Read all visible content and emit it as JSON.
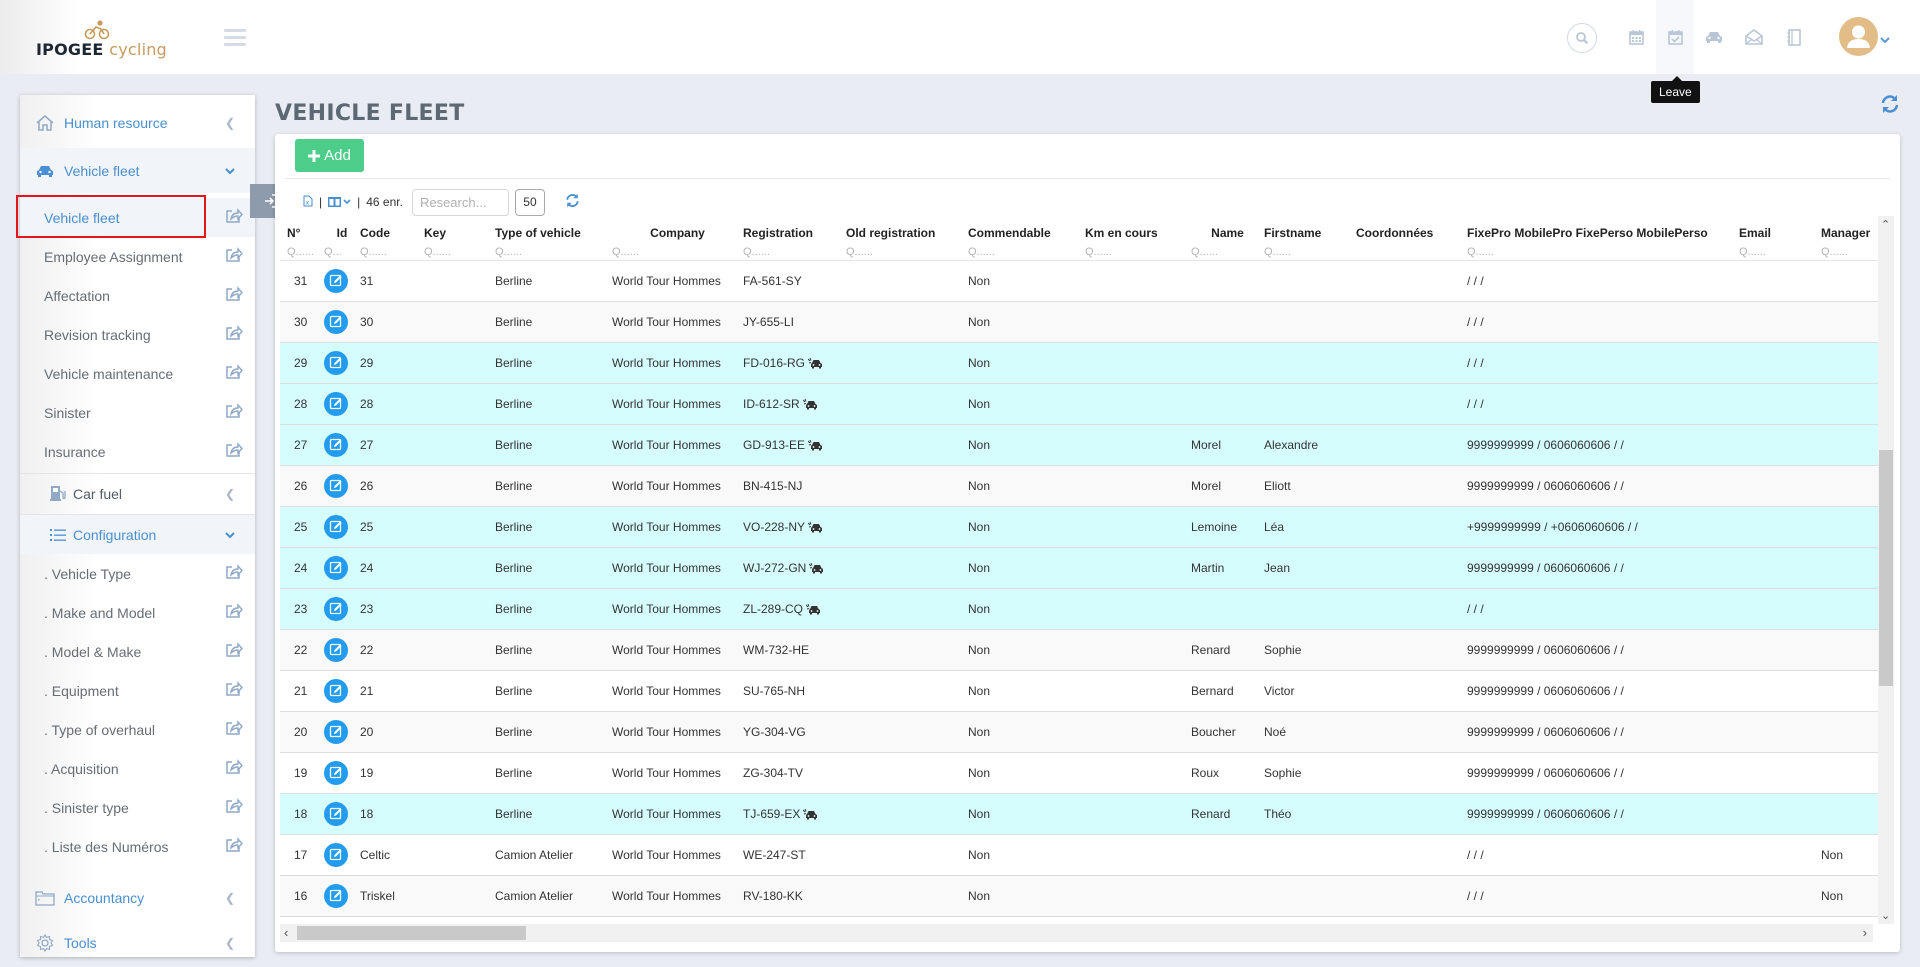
{
  "header": {
    "brand_main": "IPOGEE",
    "brand_sub": "cycling",
    "tooltip": "Leave",
    "icons": [
      "search-icon",
      "calendar-icon",
      "calendar-check-icon",
      "car-icon",
      "envelope-open-icon",
      "notebook-icon"
    ]
  },
  "sidebar": {
    "sections": [
      {
        "label": "Human resource",
        "icon": "home-icon",
        "state": "collapsed"
      },
      {
        "label": "Vehicle fleet",
        "icon": "car-icon",
        "state": "expanded"
      }
    ],
    "fleet_items": [
      {
        "label": "Vehicle fleet",
        "active": true
      },
      {
        "label": "Employee Assignment"
      },
      {
        "label": "Affectation"
      },
      {
        "label": "Revision tracking"
      },
      {
        "label": "Vehicle maintenance"
      },
      {
        "label": "Sinister"
      },
      {
        "label": "Insurance"
      }
    ],
    "car_fuel": {
      "label": "Car fuel",
      "icon": "fuel-pump-icon"
    },
    "configuration": {
      "label": "Configuration",
      "icon": "list-icon"
    },
    "config_items": [
      {
        "label": ". Vehicle Type"
      },
      {
        "label": ". Make and Model"
      },
      {
        "label": ". Model & Make"
      },
      {
        "label": ". Equipment"
      },
      {
        "label": ". Type of overhaul"
      },
      {
        "label": ". Acquisition"
      },
      {
        "label": ". Sinister type"
      },
      {
        "label": ". Liste des Numéros"
      }
    ],
    "accountancy": {
      "label": "Accountancy",
      "icon": "folder-icon"
    },
    "tools": {
      "label": "Tools",
      "icon": "gear-icon"
    }
  },
  "main": {
    "title": "VEHICLE FLEET",
    "add_label": "Add",
    "record_count": "46 enr.",
    "search_placeholder": "Research...",
    "page_size": "50",
    "filter_placeholder": "Q......",
    "filter_placeholder_short": "Q...",
    "columns": [
      "N°",
      "Id",
      "Code",
      "Key",
      "Type of vehicle",
      "Company",
      "Registration",
      "Old registration",
      "Commendable",
      "Km en cours",
      "Name",
      "Firstname",
      "Coordonnées",
      "FixePro MobilePro FixePerso MobilePerso",
      "Email",
      "Manager"
    ],
    "rows": [
      {
        "n": "31",
        "code": "31",
        "key": "",
        "type": "Berline",
        "company": "World Tour Hommes",
        "registration": "FA-561-SY",
        "car_flag": false,
        "old_reg": "",
        "commendable": "Non",
        "km": "",
        "name": "",
        "firstname": "",
        "coords": "",
        "phones": "/ / /",
        "email": "",
        "manager": "",
        "style": "odd"
      },
      {
        "n": "30",
        "code": "30",
        "key": "",
        "type": "Berline",
        "company": "World Tour Hommes",
        "registration": "JY-655-LI",
        "car_flag": false,
        "old_reg": "",
        "commendable": "Non",
        "km": "",
        "name": "",
        "firstname": "",
        "coords": "",
        "phones": "/ / /",
        "email": "",
        "manager": "",
        "style": "even"
      },
      {
        "n": "29",
        "code": "29",
        "key": "",
        "type": "Berline",
        "company": "World Tour Hommes",
        "registration": "FD-016-RG",
        "car_flag": true,
        "old_reg": "",
        "commendable": "Non",
        "km": "",
        "name": "",
        "firstname": "",
        "coords": "",
        "phones": "/ / /",
        "email": "",
        "manager": "",
        "style": "hl"
      },
      {
        "n": "28",
        "code": "28",
        "key": "",
        "type": "Berline",
        "company": "World Tour Hommes",
        "registration": "ID-612-SR",
        "car_flag": true,
        "old_reg": "",
        "commendable": "Non",
        "km": "",
        "name": "",
        "firstname": "",
        "coords": "",
        "phones": "/ / /",
        "email": "",
        "manager": "",
        "style": "hl"
      },
      {
        "n": "27",
        "code": "27",
        "key": "",
        "type": "Berline",
        "company": "World Tour Hommes",
        "registration": "GD-913-EE",
        "car_flag": true,
        "old_reg": "",
        "commendable": "Non",
        "km": "",
        "name": "Morel",
        "firstname": "Alexandre",
        "coords": "",
        "phones": "9999999999 / 0606060606 / /",
        "email": "",
        "manager": "",
        "style": "hl"
      },
      {
        "n": "26",
        "code": "26",
        "key": "",
        "type": "Berline",
        "company": "World Tour Hommes",
        "registration": "BN-415-NJ",
        "car_flag": false,
        "old_reg": "",
        "commendable": "Non",
        "km": "",
        "name": "Morel",
        "firstname": "Eliott",
        "coords": "",
        "phones": "9999999999 / 0606060606 / /",
        "email": "",
        "manager": "",
        "style": "even"
      },
      {
        "n": "25",
        "code": "25",
        "key": "",
        "type": "Berline",
        "company": "World Tour Hommes",
        "registration": "VO-228-NY",
        "car_flag": true,
        "old_reg": "",
        "commendable": "Non",
        "km": "",
        "name": "Lemoine",
        "firstname": "Léa",
        "coords": "",
        "phones": "+9999999999 / +0606060606 / /",
        "email": "",
        "manager": "",
        "style": "hl"
      },
      {
        "n": "24",
        "code": "24",
        "key": "",
        "type": "Berline",
        "company": "World Tour Hommes",
        "registration": "WJ-272-GN",
        "car_flag": true,
        "old_reg": "",
        "commendable": "Non",
        "km": "",
        "name": "Martin",
        "firstname": "Jean",
        "coords": "",
        "phones": "9999999999 / 0606060606 / /",
        "email": "",
        "manager": "",
        "style": "hl"
      },
      {
        "n": "23",
        "code": "23",
        "key": "",
        "type": "Berline",
        "company": "World Tour Hommes",
        "registration": "ZL-289-CQ",
        "car_flag": true,
        "old_reg": "",
        "commendable": "Non",
        "km": "",
        "name": "",
        "firstname": "",
        "coords": "",
        "phones": "/ / /",
        "email": "",
        "manager": "",
        "style": "hl"
      },
      {
        "n": "22",
        "code": "22",
        "key": "",
        "type": "Berline",
        "company": "World Tour Hommes",
        "registration": "WM-732-HE",
        "car_flag": false,
        "old_reg": "",
        "commendable": "Non",
        "km": "",
        "name": "Renard",
        "firstname": "Sophie",
        "coords": "",
        "phones": "9999999999 / 0606060606 / /",
        "email": "",
        "manager": "",
        "style": "even"
      },
      {
        "n": "21",
        "code": "21",
        "key": "",
        "type": "Berline",
        "company": "World Tour Hommes",
        "registration": "SU-765-NH",
        "car_flag": false,
        "old_reg": "",
        "commendable": "Non",
        "km": "",
        "name": "Bernard",
        "firstname": "Victor",
        "coords": "",
        "phones": "9999999999 / 0606060606 / /",
        "email": "",
        "manager": "",
        "style": "odd"
      },
      {
        "n": "20",
        "code": "20",
        "key": "",
        "type": "Berline",
        "company": "World Tour Hommes",
        "registration": "YG-304-VG",
        "car_flag": false,
        "old_reg": "",
        "commendable": "Non",
        "km": "",
        "name": "Boucher",
        "firstname": "Noé",
        "coords": "",
        "phones": "9999999999 / 0606060606 / /",
        "email": "",
        "manager": "",
        "style": "even"
      },
      {
        "n": "19",
        "code": "19",
        "key": "",
        "type": "Berline",
        "company": "World Tour Hommes",
        "registration": "ZG-304-TV",
        "car_flag": false,
        "old_reg": "",
        "commendable": "Non",
        "km": "",
        "name": "Roux",
        "firstname": "Sophie",
        "coords": "",
        "phones": "9999999999 / 0606060606 / /",
        "email": "",
        "manager": "",
        "style": "odd"
      },
      {
        "n": "18",
        "code": "18",
        "key": "",
        "type": "Berline",
        "company": "World Tour Hommes",
        "registration": "TJ-659-EX",
        "car_flag": true,
        "old_reg": "",
        "commendable": "Non",
        "km": "",
        "name": "Renard",
        "firstname": "Théo",
        "coords": "",
        "phones": "9999999999 / 0606060606 / /",
        "email": "",
        "manager": "",
        "style": "hl"
      },
      {
        "n": "17",
        "code": "Celtic",
        "key": "",
        "type": "Camion Atelier",
        "company": "World Tour Hommes",
        "registration": "WE-247-ST",
        "car_flag": false,
        "old_reg": "",
        "commendable": "Non",
        "km": "",
        "name": "",
        "firstname": "",
        "coords": "",
        "phones": "/ / /",
        "email": "",
        "manager": "Non",
        "style": "odd"
      },
      {
        "n": "16",
        "code": "Triskel",
        "key": "",
        "type": "Camion Atelier",
        "company": "World Tour Hommes",
        "registration": "RV-180-KK",
        "car_flag": false,
        "old_reg": "",
        "commendable": "Non",
        "km": "",
        "name": "",
        "firstname": "",
        "coords": "",
        "phones": "/ / /",
        "email": "",
        "manager": "Non",
        "style": "even"
      }
    ]
  },
  "colors": {
    "accent_blue": "#4a8fd1",
    "add_green": "#4ccd8a",
    "edit_blue": "#239bee",
    "highlight_row": "#d6fdfd",
    "selection_box": "#e4161b",
    "brand_gold": "#c79a5e"
  }
}
